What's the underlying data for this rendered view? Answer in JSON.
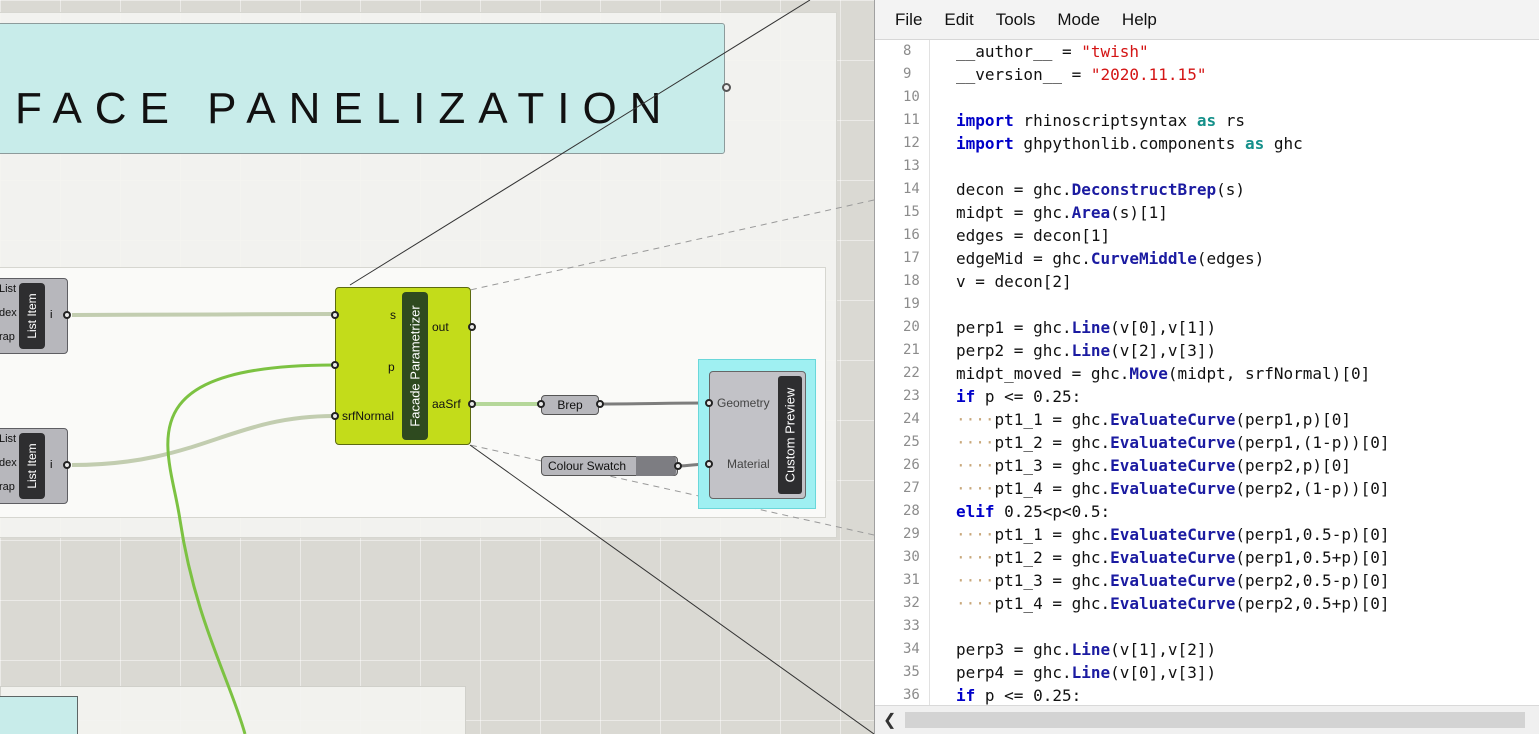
{
  "canvas": {
    "title": "FACE PANELIZATION",
    "list_item_1": {
      "label": "List Item",
      "inputs": [
        "List",
        "dex",
        "rap"
      ],
      "output": "i"
    },
    "list_item_2": {
      "label": "List Item",
      "inputs": [
        "List",
        "dex",
        "rap"
      ],
      "output": "i"
    },
    "facade": {
      "label": "Facade Parametrizer",
      "inputs": [
        "s",
        "p",
        "srfNormal"
      ],
      "outputs": [
        "out",
        "aaSrf"
      ]
    },
    "brep": "Brep",
    "colour_swatch": "Colour Swatch",
    "preview": {
      "label": "Custom Preview",
      "inputs": [
        "Geometry",
        "Material"
      ]
    },
    "component_color": "#c3dc1a",
    "wire_color": "#7cc242"
  },
  "editor": {
    "menu": [
      "File",
      "Edit",
      "Tools",
      "Mode",
      "Help"
    ],
    "lines": [
      {
        "n": "8",
        "html": "__author__ = <span class='str'>\"twish\"</span>"
      },
      {
        "n": "9",
        "html": "__version__ = <span class='str'>\"2020.11.15\"</span>"
      },
      {
        "n": "10",
        "html": ""
      },
      {
        "n": "11",
        "html": "<span class='kw'>import</span> rhinoscriptsyntax <span class='kw2'>as</span> rs"
      },
      {
        "n": "12",
        "html": "<span class='kw'>import</span> ghpythonlib.components <span class='kw2'>as</span> ghc"
      },
      {
        "n": "13",
        "html": ""
      },
      {
        "n": "14",
        "html": "decon = ghc.<span class='fn'>DeconstructBrep</span>(s)"
      },
      {
        "n": "15",
        "html": "midpt = ghc.<span class='fn'>Area</span>(s)[1]"
      },
      {
        "n": "16",
        "html": "edges = decon[1]"
      },
      {
        "n": "17",
        "html": "edgeMid = ghc.<span class='fn'>CurveMiddle</span>(edges)"
      },
      {
        "n": "18",
        "html": "v = decon[2]"
      },
      {
        "n": "19",
        "html": ""
      },
      {
        "n": "20",
        "html": "perp1 = ghc.<span class='fn'>Line</span>(v[0],v[1])"
      },
      {
        "n": "21",
        "html": "perp2 = ghc.<span class='fn'>Line</span>(v[2],v[3])"
      },
      {
        "n": "22",
        "html": "midpt_moved = ghc.<span class='fn'>Move</span>(midpt, srfNormal)[0]"
      },
      {
        "n": "23",
        "html": "<span class='kw'>if</span> p &lt;= 0.25:"
      },
      {
        "n": "24",
        "html": "<span class='dots'>····</span>pt1_1 = ghc.<span class='fn'>EvaluateCurve</span>(perp1,p)[0]"
      },
      {
        "n": "25",
        "html": "<span class='dots'>····</span>pt1_2 = ghc.<span class='fn'>EvaluateCurve</span>(perp1,(1-p))[0]"
      },
      {
        "n": "26",
        "html": "<span class='dots'>····</span>pt1_3 = ghc.<span class='fn'>EvaluateCurve</span>(perp2,p)[0]"
      },
      {
        "n": "27",
        "html": "<span class='dots'>····</span>pt1_4 = ghc.<span class='fn'>EvaluateCurve</span>(perp2,(1-p))[0]"
      },
      {
        "n": "28",
        "html": "<span class='kw'>elif</span> 0.25&lt;p&lt;0.5:"
      },
      {
        "n": "29",
        "html": "<span class='dots'>····</span>pt1_1 = ghc.<span class='fn'>EvaluateCurve</span>(perp1,0.5-p)[0]"
      },
      {
        "n": "30",
        "html": "<span class='dots'>····</span>pt1_2 = ghc.<span class='fn'>EvaluateCurve</span>(perp1,0.5+p)[0]"
      },
      {
        "n": "31",
        "html": "<span class='dots'>····</span>pt1_3 = ghc.<span class='fn'>EvaluateCurve</span>(perp2,0.5-p)[0]"
      },
      {
        "n": "32",
        "html": "<span class='dots'>····</span>pt1_4 = ghc.<span class='fn'>EvaluateCurve</span>(perp2,0.5+p)[0]"
      },
      {
        "n": "33",
        "html": ""
      },
      {
        "n": "34",
        "html": "perp3 = ghc.<span class='fn'>Line</span>(v[1],v[2])"
      },
      {
        "n": "35",
        "html": "perp4 = ghc.<span class='fn'>Line</span>(v[0],v[3])"
      },
      {
        "n": "36",
        "html": "<span class='kw'>if</span> p &lt;= 0.25:"
      }
    ],
    "scroll_left_icon": "chevron-left-icon"
  }
}
